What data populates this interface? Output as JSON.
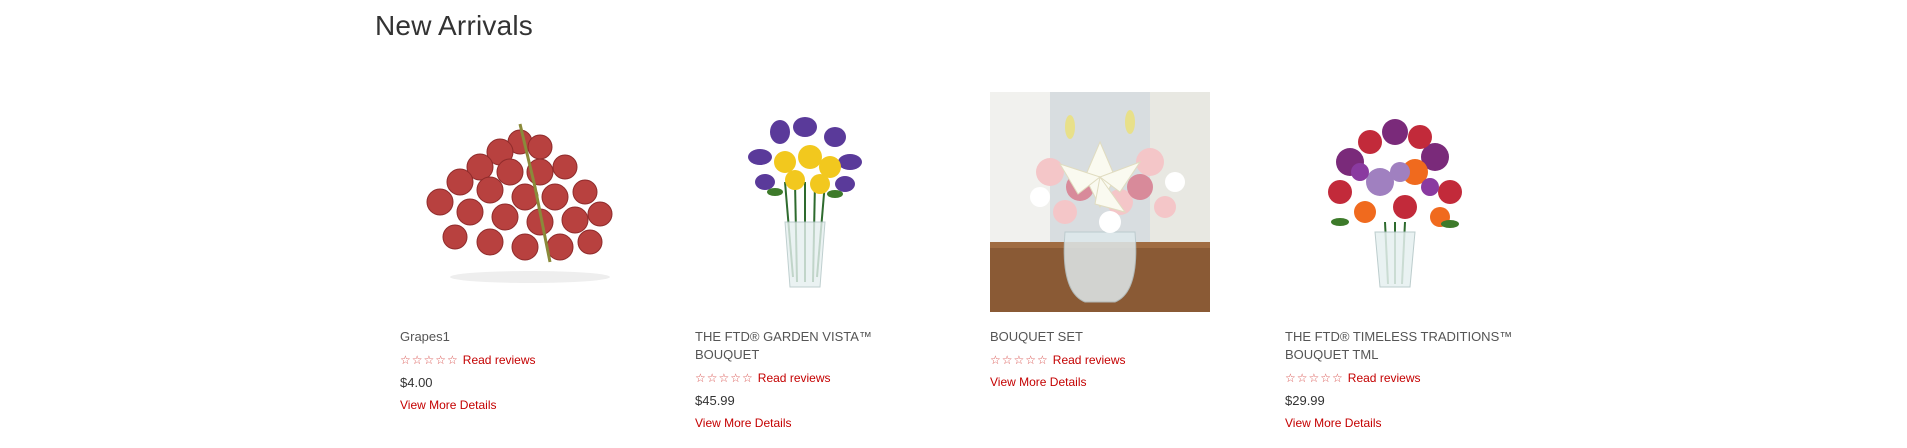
{
  "section": {
    "title": "New Arrivals"
  },
  "products": [
    {
      "name": "Grapes1",
      "stars": "☆☆☆☆☆",
      "reviews_label": "Read reviews",
      "price": "$4.00",
      "details_label": "View More Details",
      "image_icon": "grapes-image"
    },
    {
      "name": "THE FTD® GARDEN VISTA™ BOUQUET",
      "stars": "☆☆☆☆☆",
      "reviews_label": "Read reviews",
      "price": "$45.99",
      "details_label": "View More Details",
      "image_icon": "iris-bouquet-image"
    },
    {
      "name": "BOUQUET SET",
      "stars": "☆☆☆☆☆",
      "reviews_label": "Read reviews",
      "price": "",
      "details_label": "View More Details",
      "image_icon": "lily-bouquet-image"
    },
    {
      "name": "THE FTD® TIMELESS TRADITIONS™ BOUQUET TML",
      "stars": "☆☆☆☆☆",
      "reviews_label": "Read reviews",
      "price": "$29.99",
      "details_label": "View More Details",
      "image_icon": "rose-bouquet-image"
    }
  ],
  "colors": {
    "link": "#c40000",
    "text": "#555555",
    "title": "#333333"
  }
}
